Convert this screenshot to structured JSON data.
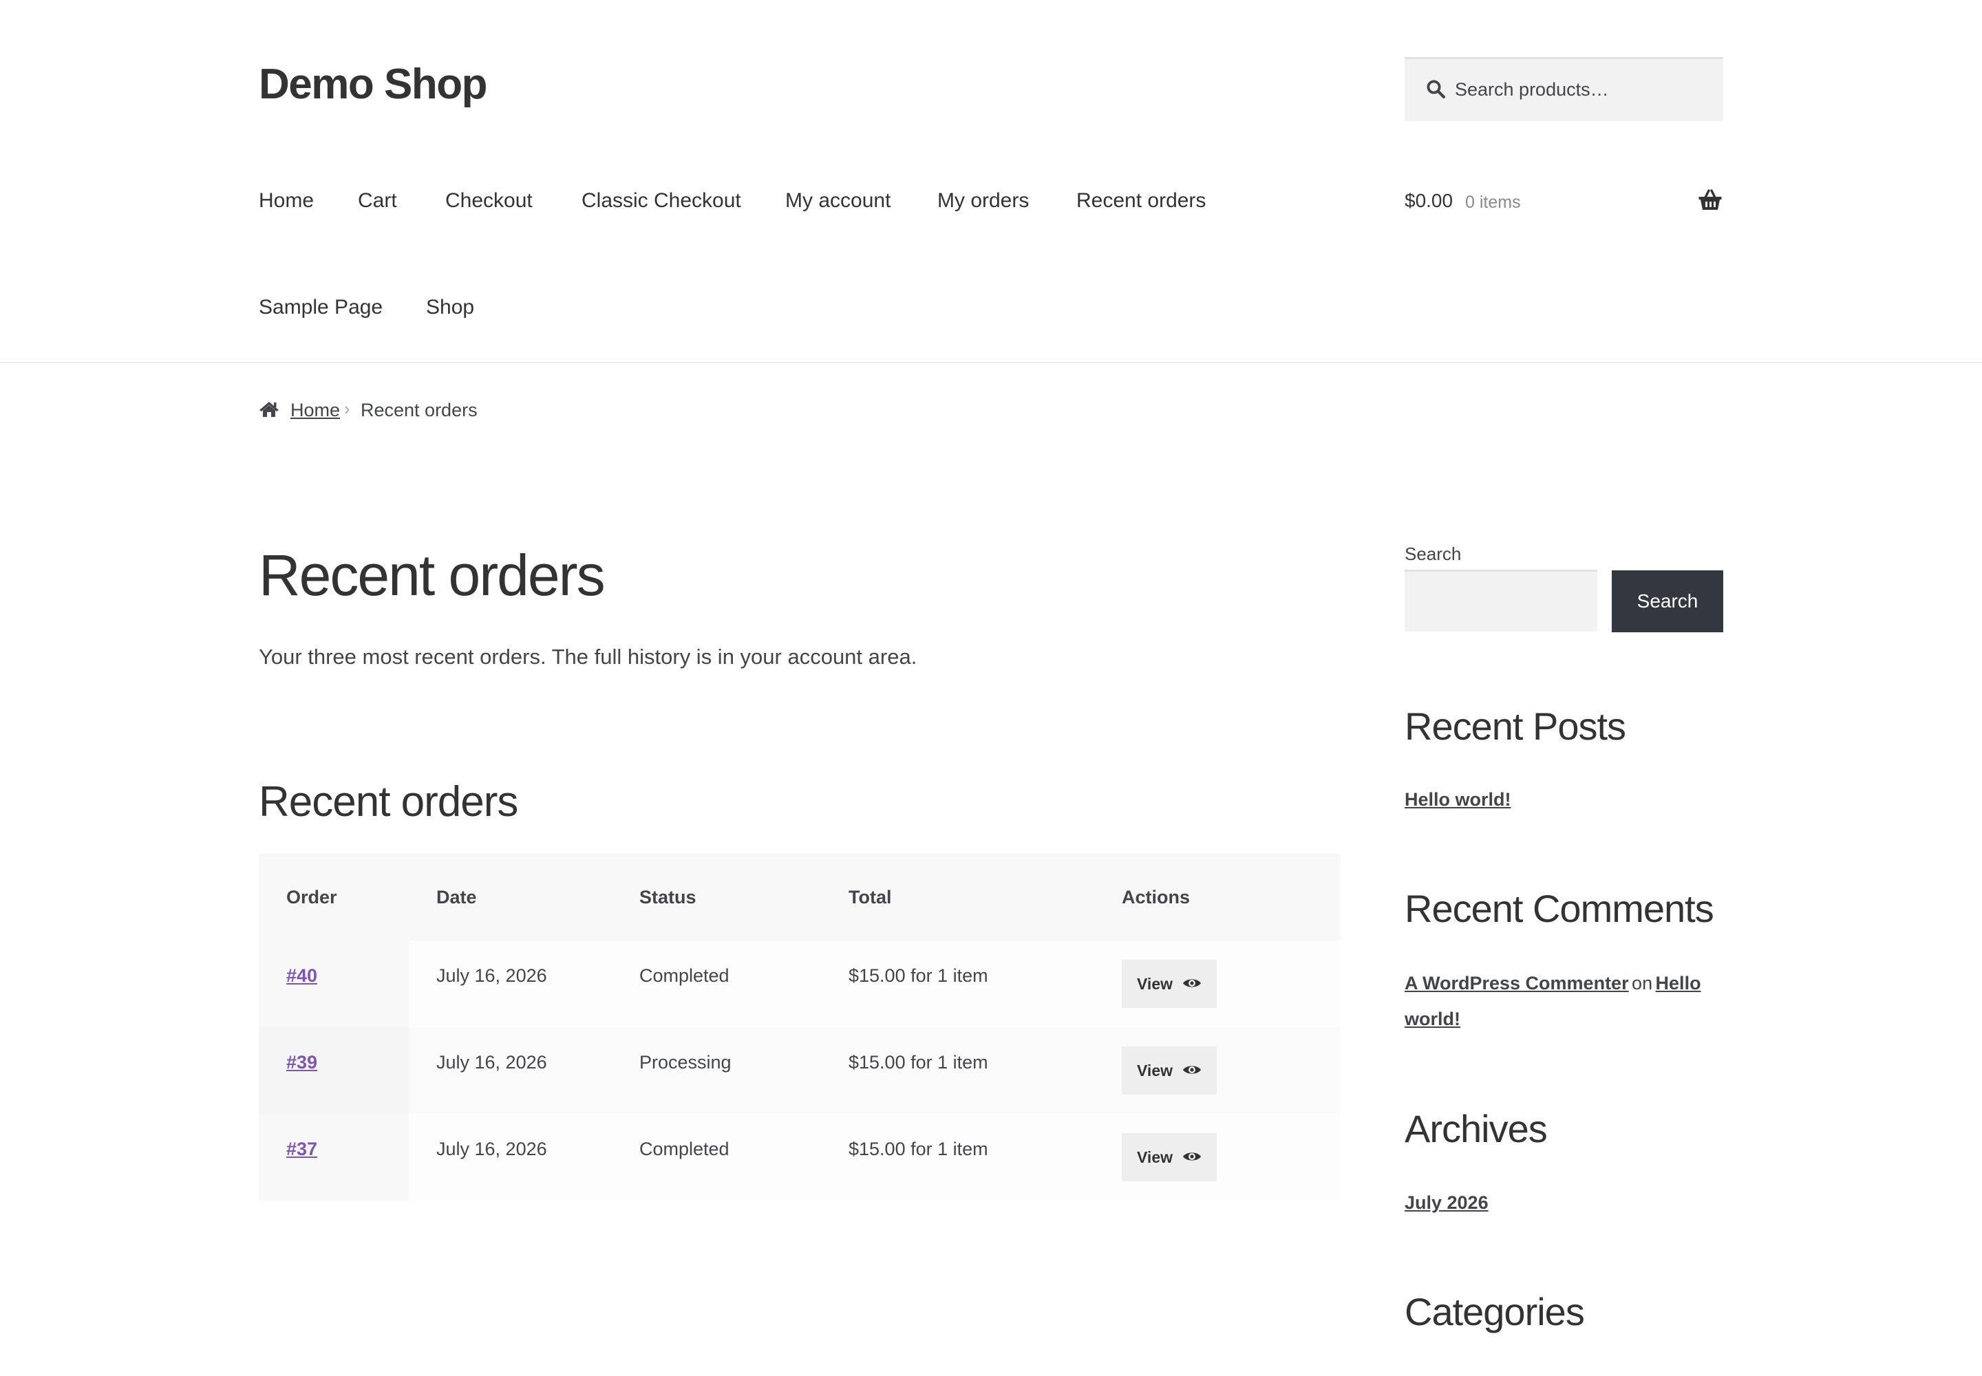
{
  "site": {
    "title": "Demo Shop"
  },
  "search": {
    "placeholder": "Search products…"
  },
  "nav": {
    "items": [
      {
        "label": "Home"
      },
      {
        "label": "Cart"
      },
      {
        "label": "Checkout"
      },
      {
        "label": "Classic Checkout"
      },
      {
        "label": "My account"
      },
      {
        "label": "My orders"
      },
      {
        "label": "Recent orders"
      },
      {
        "label": "Sample Page"
      },
      {
        "label": "Shop"
      }
    ]
  },
  "cart": {
    "total": "$0.00",
    "count": "0 items"
  },
  "breadcrumb": {
    "home": "Home",
    "current": "Recent orders"
  },
  "page": {
    "title": "Recent orders",
    "intro": "Your three most recent orders. The full history is in your account area.",
    "section_title": "Recent orders"
  },
  "orders_table": {
    "headers": [
      "Order",
      "Date",
      "Status",
      "Total",
      "Actions"
    ],
    "rows": [
      {
        "order": "#40",
        "date": "July 16, 2026",
        "status": "Completed",
        "total": "$15.00 for 1 item",
        "action": "View"
      },
      {
        "order": "#39",
        "date": "July 16, 2026",
        "status": "Processing",
        "total": "$15.00 for 1 item",
        "action": "View"
      },
      {
        "order": "#37",
        "date": "July 16, 2026",
        "status": "Completed",
        "total": "$15.00 for 1 item",
        "action": "View"
      }
    ]
  },
  "sidebar": {
    "search_label": "Search",
    "search_button": "Search",
    "recent_posts": {
      "title": "Recent Posts",
      "items": [
        "Hello world!"
      ]
    },
    "recent_comments": {
      "title": "Recent Comments",
      "items": [
        {
          "author": "A WordPress Commenter",
          "on": "on",
          "post_line1": "Hello",
          "post_line2": "world!"
        }
      ]
    },
    "archives": {
      "title": "Archives",
      "items": [
        "July 2026"
      ]
    },
    "categories": {
      "title": "Categories"
    }
  },
  "colors": {
    "accent_link": "#7f54b3",
    "button_dark": "#333840",
    "text": "#43454b",
    "heading": "#333333"
  },
  "icons": {
    "search": "search-icon",
    "basket": "basket-icon",
    "home": "home-icon",
    "view": "eye-icon"
  }
}
